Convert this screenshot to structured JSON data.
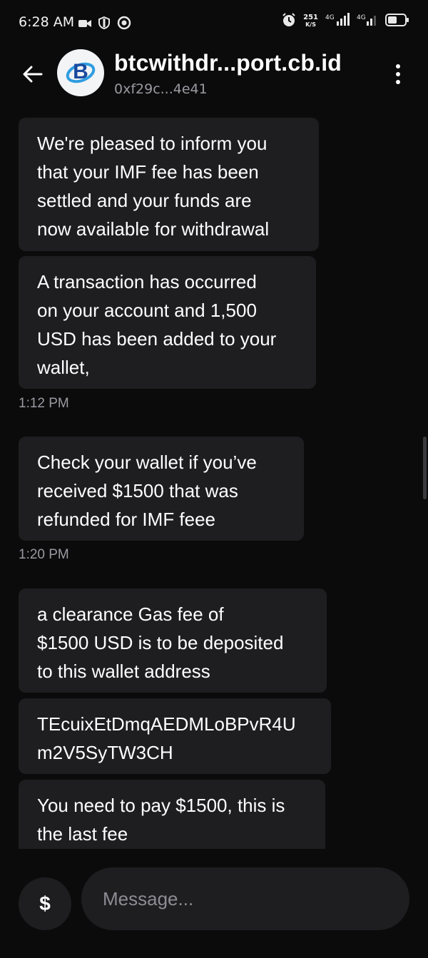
{
  "status_bar": {
    "time": "6:28 AM",
    "net_speed_value": "251",
    "net_speed_unit": "K/S",
    "signal_1_label": "4G",
    "signal_2_label": "4G"
  },
  "header": {
    "contact_name": "btcwithdr...port.cb.id",
    "contact_address": "0xf29c...4e41",
    "avatar_letter": "B"
  },
  "messages": [
    {
      "text": "We're pleased to inform you\nthat your IMF fee has been\nsettled and your funds are\nnow available for withdrawal"
    },
    {
      "text": "A transaction has occurred\non your account and 1,500\nUSD has been added to your\nwallet,"
    },
    {
      "timestamp": "1:12 PM"
    },
    {
      "text": "Check your wallet if you’ve\nreceived $1500 that was\nrefunded for IMF feee"
    },
    {
      "timestamp": "1:20 PM"
    },
    {
      "text": "a clearance Gas fee of\n$1500 USD is to be deposited\nto this wallet address"
    },
    {
      "text": "TEcuixEtDmqAEDMLoBPvR4U\nm2V5SyTW3CH"
    },
    {
      "text": "You need to pay $1500, this is\nthe last fee"
    }
  ],
  "composer": {
    "currency_button_label": "$",
    "placeholder": "Message..."
  },
  "colors": {
    "background": "#0b0b0c",
    "bubble": "#1e1e21",
    "muted_text": "#9a9aa1",
    "brand_blue": "#1a6fd6"
  }
}
